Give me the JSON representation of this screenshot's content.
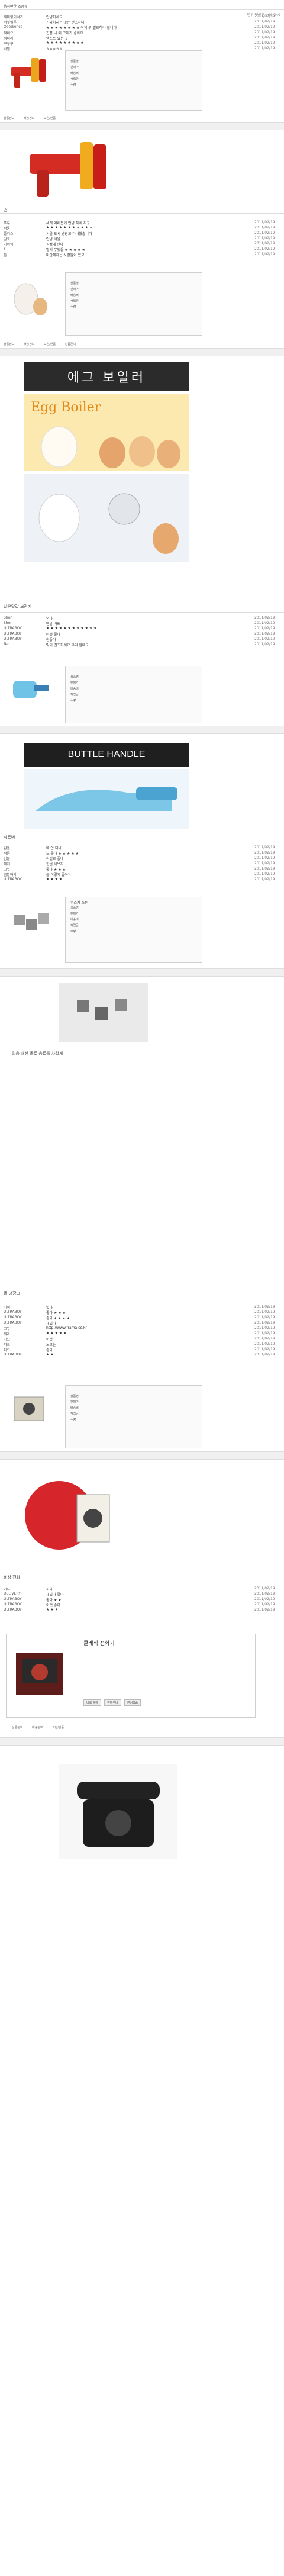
{
  "header": {
    "title": "음식만한 소품류",
    "meta": "맨위 덧글란 · 90/349"
  },
  "posts": [
    {
      "comments": [
        {
          "name": "재미없어서가",
          "text": "안녕하세요",
          "date": "2011/02/19"
        },
        {
          "name": "버킷멜론",
          "text": "진짜하지는 않은 건조하다",
          "date": "2011/02/19"
        },
        {
          "name": "Obedience",
          "text": "★ ★ ★ ★ ★ ★ ★ ★ 이게 뭐 필요하나 합니다",
          "date": "2011/02/19"
        },
        {
          "name": "쩌네요",
          "text": "진품 나 왜 구매가 좋아요",
          "date": "2011/02/19"
        },
        {
          "name": "뭐더라",
          "text": "텍스트 있는 곳",
          "date": "2011/02/19"
        },
        {
          "name": "꾸꾸꾸",
          "text": "★ ★ ★ ★ ★ ★ ★ ★ ★",
          "date": "2011/02/19"
        },
        {
          "name": "비밀",
          "text": "ㅎㅎㅎㅎㅎ",
          "date": "2011/02/19"
        }
      ],
      "caption": "건"
    },
    {
      "comments": [
        {
          "name": "푸우",
          "text": "세계 여러분께 안녕 하세 지구",
          "date": "2011/02/19"
        },
        {
          "name": "짝퉁",
          "text": "★ ★ ★ ★ ★ ★ ★ ★ ★ ★ ★",
          "date": "2011/02/19"
        },
        {
          "name": "플러스",
          "text": "서울 도시 냉장고 다녀왔습니다",
          "date": "2011/02/19"
        },
        {
          "name": "발로",
          "text": "안녕 서울",
          "date": "2011/02/19"
        },
        {
          "name": "아이템",
          "text": "삼성에 판매",
          "date": "2011/02/19"
        },
        {
          "name": "Y",
          "text": "딸기 무엇을 ★ ★ ★ ★ ★",
          "date": "2011/02/19"
        },
        {
          "name": "둘",
          "text": "미안해하는 사람들이 있고",
          "date": "2011/02/19"
        }
      ],
      "banner_title": "에그 보일러",
      "banner_sub": "Egg Boiler",
      "caption": "삶은달걀 보관기"
    },
    {
      "comments": [
        {
          "name": "Shon",
          "text": "외다",
          "date": "2011/02/19"
        },
        {
          "name": "Shon",
          "text": "맨날 바쁘",
          "date": "2011/02/19"
        },
        {
          "name": "ULTRABOY",
          "text": "★ ★ ★ ★ ★ ★ ★ ★ ★ ★ ★ ★",
          "date": "2011/02/19"
        },
        {
          "name": "ULTRABOY",
          "text": "이것 좋다",
          "date": "2011/02/19"
        },
        {
          "name": "ULTRABOY",
          "text": "참좋아",
          "date": "2011/02/19"
        },
        {
          "name": "Ted",
          "text": "맞이 건조하세요 우리 할때도",
          "date": "2011/02/19"
        }
      ],
      "banner_title": "BUTTLE HANDLE",
      "caption": "페트병"
    },
    {
      "comments": [
        {
          "name": "갑돌",
          "text": "왜 안 되나",
          "date": "2011/02/19"
        },
        {
          "name": "짝퉁",
          "text": "오 좋다 ★ ★ ★ ★ ★",
          "date": "2011/02/19"
        },
        {
          "name": "갑돌",
          "text": "이걸로 좋네",
          "date": "2011/02/19"
        },
        {
          "name": "헤헤",
          "text": "한번 사보자",
          "date": "2011/02/19"
        },
        {
          "name": "고무",
          "text": "좋다 ★ ★ ★",
          "date": "2011/02/19"
        },
        {
          "name": "곰발바닥",
          "text": "돌 이렇게 좋아?",
          "date": "2011/02/19"
        },
        {
          "name": "ULTRABOY",
          "text": "★ ★ ★ ★",
          "date": "2011/02/19"
        }
      ],
      "panel_title": "위스키 스톤",
      "panel_text": "얼음 대신 돌로 음료를 차갑게",
      "caption": "돌 냉장고"
    },
    {
      "comments": [
        {
          "name": "니어",
          "text": "있다",
          "date": "2011/02/19"
        },
        {
          "name": "ULTRABOY",
          "text": "좋다 ★ ★ ★",
          "date": "2011/02/19"
        },
        {
          "name": "ULTRABOY",
          "text": "좋다 ★ ★ ★ ★",
          "date": "2011/02/19"
        },
        {
          "name": "ULTRABOY",
          "text": "재밌다",
          "date": "2011/02/19"
        },
        {
          "name": "고무",
          "text": "http://www.frama.co.kr",
          "date": "2011/02/19"
        },
        {
          "name": "뭐라",
          "text": "★ ★ ★ ★ ★",
          "date": "2011/02/19"
        },
        {
          "name": "마요",
          "text": "이것",
          "date": "2011/02/19"
        },
        {
          "name": "파요",
          "text": "노크는",
          "date": "2011/02/19"
        },
        {
          "name": "파요",
          "text": "좋다",
          "date": "2011/02/19"
        },
        {
          "name": "ULTRABOY",
          "text": "★ ★",
          "date": "2011/02/19"
        }
      ],
      "caption": "비상 전화"
    },
    {
      "comments": [
        {
          "name": "이유",
          "text": "하다",
          "date": "2011/02/19"
        },
        {
          "name": "DELIVERY",
          "text": "재밌다 좋아",
          "date": "2011/02/19"
        },
        {
          "name": "ULTRABOY",
          "text": "좋다 ★ ★",
          "date": "2011/02/19"
        },
        {
          "name": "ULTRABOY",
          "text": "이것 좋아",
          "date": "2011/02/19"
        },
        {
          "name": "ULTRABOY",
          "text": "★ ★ ★",
          "date": "2011/02/19"
        }
      ],
      "panel_title": "클래식 전화기"
    }
  ],
  "shop": {
    "rows": [
      "상품명",
      "판매가",
      "배송비",
      "적립금",
      "수량"
    ],
    "buttons": [
      "바로 구매",
      "장바구니",
      "관심상품"
    ],
    "tabs": [
      "상품정보",
      "배송정보",
      "교환/반품",
      "상품문의"
    ]
  },
  "colors": {
    "accent": "#e8343a",
    "link": "#3a5aa8",
    "bar": "#f0f0f0"
  }
}
